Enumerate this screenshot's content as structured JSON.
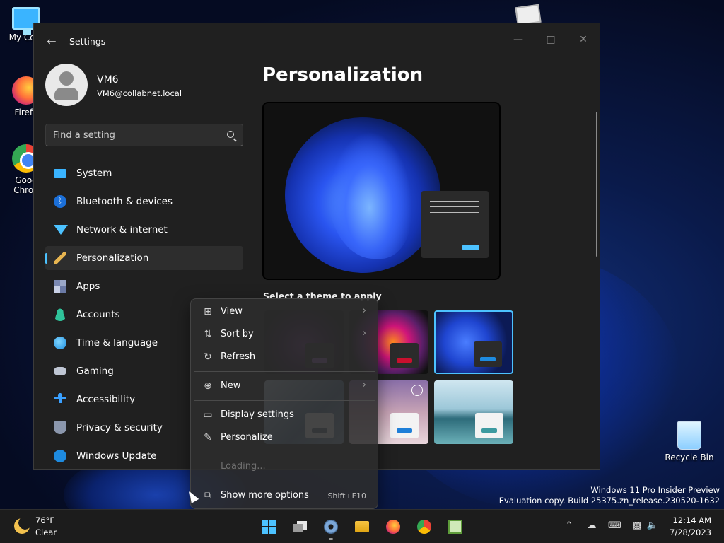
{
  "desktop": {
    "icons": [
      {
        "label": "My Com"
      },
      {
        "label": "Firefo"
      },
      {
        "label": "Goog\nChron"
      },
      {
        "label": ""
      },
      {
        "label": "Recycle Bin"
      }
    ],
    "watermark": {
      "line1": "Windows 11 Pro Insider Preview",
      "line2": "Evaluation copy. Build 25375.zn_release.230520-1632"
    }
  },
  "settings": {
    "title": "Settings",
    "user": {
      "name": "VM6",
      "email": "VM6@collabnet.local"
    },
    "search": {
      "placeholder": "Find a setting"
    },
    "nav": [
      {
        "label": "System",
        "icon": "monitor-icon"
      },
      {
        "label": "Bluetooth & devices",
        "icon": "bluetooth-icon"
      },
      {
        "label": "Network & internet",
        "icon": "wifi-icon"
      },
      {
        "label": "Personalization",
        "icon": "brush-icon",
        "active": true
      },
      {
        "label": "Apps",
        "icon": "apps-icon"
      },
      {
        "label": "Accounts",
        "icon": "person-icon"
      },
      {
        "label": "Time & language",
        "icon": "globe-clock-icon"
      },
      {
        "label": "Gaming",
        "icon": "controller-icon"
      },
      {
        "label": "Accessibility",
        "icon": "accessibility-icon"
      },
      {
        "label": "Privacy & security",
        "icon": "shield-icon"
      },
      {
        "label": "Windows Update",
        "icon": "update-icon"
      }
    ],
    "page_title": "Personalization",
    "theme_section_label": "Select a theme to apply",
    "accent_color": "#4cc2ff"
  },
  "context_menu": {
    "items": [
      {
        "label": "View",
        "icon": "grid-icon",
        "submenu": true
      },
      {
        "label": "Sort by",
        "icon": "sort-icon",
        "submenu": true
      },
      {
        "label": "Refresh",
        "icon": "refresh-icon"
      },
      {
        "label": "New",
        "icon": "plus-circle-icon",
        "submenu": true
      },
      {
        "label": "Display settings",
        "icon": "display-icon"
      },
      {
        "label": "Personalize",
        "icon": "pen-icon"
      },
      {
        "label": "Loading...",
        "disabled": true
      },
      {
        "label": "Show more options",
        "icon": "share-icon",
        "shortcut": "Shift+F10"
      }
    ]
  },
  "taskbar": {
    "weather": {
      "temp": "76°F",
      "condition": "Clear"
    },
    "clock": {
      "time": "12:14 AM",
      "date": "7/28/2023"
    }
  }
}
